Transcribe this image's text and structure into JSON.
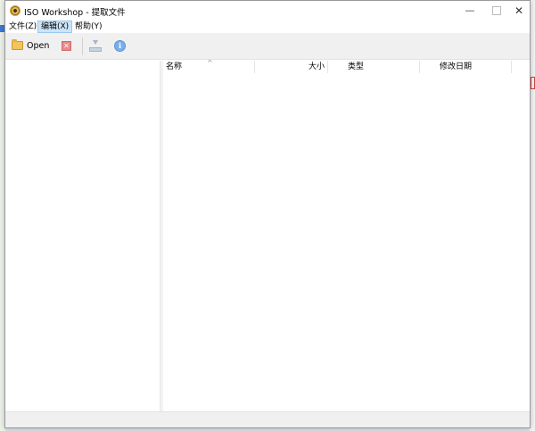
{
  "window": {
    "title": "ISO Workshop - 提取文件",
    "controls": {
      "minimize": "—",
      "close": "✕"
    }
  },
  "menu": {
    "file": "文件(Z)",
    "edit": "编辑(X)",
    "help": "帮助(Y)"
  },
  "toolbar": {
    "open_label": "Open",
    "close_glyph": "✕",
    "info_glyph": "i"
  },
  "file_list": {
    "columns": [
      "名称",
      "大小",
      "类型",
      "修改日期"
    ],
    "sort_indicator": "^",
    "rows": []
  },
  "colors": {
    "menu_highlight": "#cce4f7",
    "toolbar_bg": "#f0f0f0",
    "close_red": "#e88a8a",
    "info_blue": "#7ab0e8",
    "folder_yellow": "#f3c45a"
  }
}
